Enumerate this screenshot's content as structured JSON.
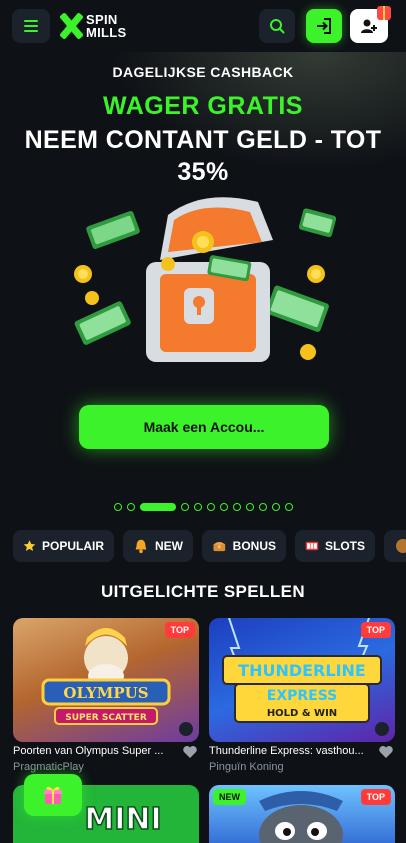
{
  "header": {
    "logo_line1": "SPIN",
    "logo_line2": "MILLS",
    "menu_icon": "hamburger-icon",
    "search_icon": "search-icon",
    "login_icon": "login-icon",
    "register_icon": "add-user-icon",
    "accent": "#3cf22a"
  },
  "hero": {
    "label": "DAGELIJKSE CASHBACK",
    "headline": "WAGER GRATIS",
    "subline": "NEEM CONTANT GELD - TOT 35%",
    "cta": "Maak een Accou...",
    "slide_index": 3,
    "slide_count": 12
  },
  "categories": [
    {
      "label": "POPULAIR",
      "icon": "star-icon"
    },
    {
      "label": "NEW",
      "icon": "bell-icon"
    },
    {
      "label": "BONUS",
      "icon": "treasure-icon"
    },
    {
      "label": "SLOTS",
      "icon": "slot-reels-icon"
    }
  ],
  "section": {
    "title": "UITGELICHTE SPELLEN"
  },
  "games": [
    {
      "title": "Poorten van Olympus Super ...",
      "provider": "PragmaticPlay",
      "tag": "TOP",
      "art": "GATES OF OLYMPUS",
      "art_sub": "SUPER SCATTER"
    },
    {
      "title": "Thunderline Express: vasthou...",
      "provider": "Pinguïn Koning",
      "tag": "TOP",
      "art": "THUNDERLINE EXPRESS",
      "art_sub": "HOLD & WIN"
    },
    {
      "title": "",
      "provider": "",
      "tag": "",
      "art": "MINI GAMES",
      "art_sub": ""
    },
    {
      "title": "",
      "provider": "",
      "tag": "TOP",
      "tag_new": "NEW",
      "art": "",
      "art_sub": ""
    }
  ]
}
